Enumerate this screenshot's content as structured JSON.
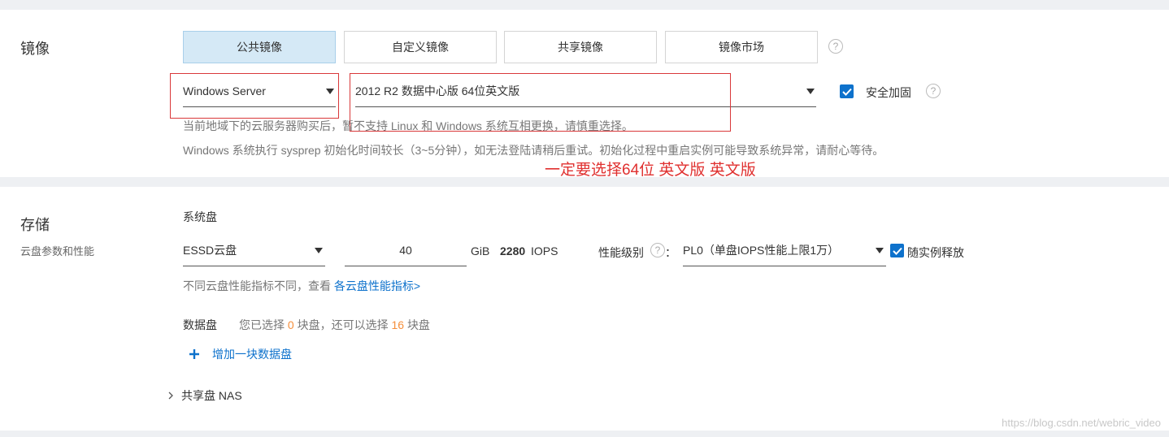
{
  "image_section": {
    "title": "镜像",
    "tabs": [
      {
        "label": "公共镜像",
        "active": true
      },
      {
        "label": "自定义镜像",
        "active": false
      },
      {
        "label": "共享镜像",
        "active": false
      },
      {
        "label": "镜像市场",
        "active": false
      }
    ],
    "os_select": "Windows Server",
    "version_select": "2012 R2 数据中心版 64位英文版",
    "security_label": "安全加固",
    "security_checked": true,
    "hint1": "当前地域下的云服务器购买后，暂不支持 Linux 和 Windows 系统互相更换，请慎重选择。",
    "hint2": "Windows 系统执行 sysprep 初始化时间较长（3~5分钟），如无法登陆请稍后重试。初始化过程中重启实例可能导致系统异常，请耐心等待。",
    "annotation": "一定要选择64位  英文版 英文版",
    "help_icon": "?"
  },
  "storage_section": {
    "title": "存储",
    "subtitle": "云盘参数和性能",
    "system_disk_label": "系统盘",
    "disk_type": "ESSD云盘",
    "disk_size": "40",
    "size_unit": "GiB",
    "iops_value": "2280",
    "iops_unit": "IOPS",
    "perf_level_label": "性能级别",
    "perf_level_colon": "：",
    "perf_level_value": "PL0（单盘IOPS性能上限1万）",
    "release_label": "随实例释放",
    "release_checked": true,
    "perf_hint_prefix": "不同云盘性能指标不同，查看",
    "perf_hint_link": "各云盘性能指标>",
    "data_disk_label": "数据盘",
    "data_disk_text_a": "您已选择",
    "data_disk_selected": "0",
    "data_disk_text_b": "块盘，还可以选择",
    "data_disk_remaining": "16",
    "data_disk_text_c": "块盘",
    "add_disk_label": "增加一块数据盘",
    "nas_label": "共享盘 NAS"
  },
  "watermark": "https://blog.csdn.net/webric_video",
  "colors": {
    "accent": "#0e72cc",
    "annotation_red": "#e0302f",
    "count_orange": "#f58f3c",
    "active_tab_bg": "#d5e9f6"
  }
}
